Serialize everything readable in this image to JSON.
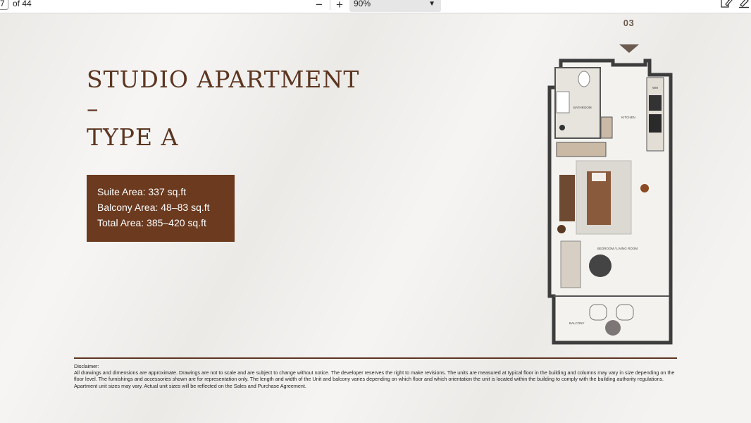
{
  "toolbar": {
    "page_current": "7",
    "page_total": "of 44",
    "zoom_value": "90%",
    "icons": [
      "minus-icon",
      "plus-icon",
      "chevron-down-icon",
      "draw-icon",
      "highlight-icon"
    ]
  },
  "content": {
    "title_line1": "STUDIO APARTMENT –",
    "title_line2": "TYPE A",
    "suite_area": "Suite Area: 337 sq.ft",
    "balcony_area": "Balcony Area: 48–83 sq.ft",
    "total_area": "Total Area: 385–420 sq.ft",
    "unit_number": "03",
    "disclaimer_label": "Disclaimer:",
    "disclaimer_text": "All drawings and dimensions are approximate. Drawings are not to scale and are subject to change without notice. The developer reserves the right to make revisions. The units are measured at typical floor in the building and columns may vary in size depending on the floor level. The furnishings and accessories shown are for representation only. The length and width of the Unit and balcony varies depending on which floor and which orientation the unit is located within the building to comply with the building authority regulations. Apartment unit sizes may vary. Actual unit sizes will be reflected on the Sales and Purchase Agreement."
  },
  "plan_labels": {
    "bathroom": "BATHROOM",
    "kitchen": "KITCHEN",
    "wm": "WM",
    "bedroom_living": "BEDROOM / LIVING ROOM",
    "balcony": "BALCONY"
  },
  "colors": {
    "accent_brown": "#6b3a1f",
    "title_brown": "#5c3621",
    "page_bg": "#eceae7"
  }
}
